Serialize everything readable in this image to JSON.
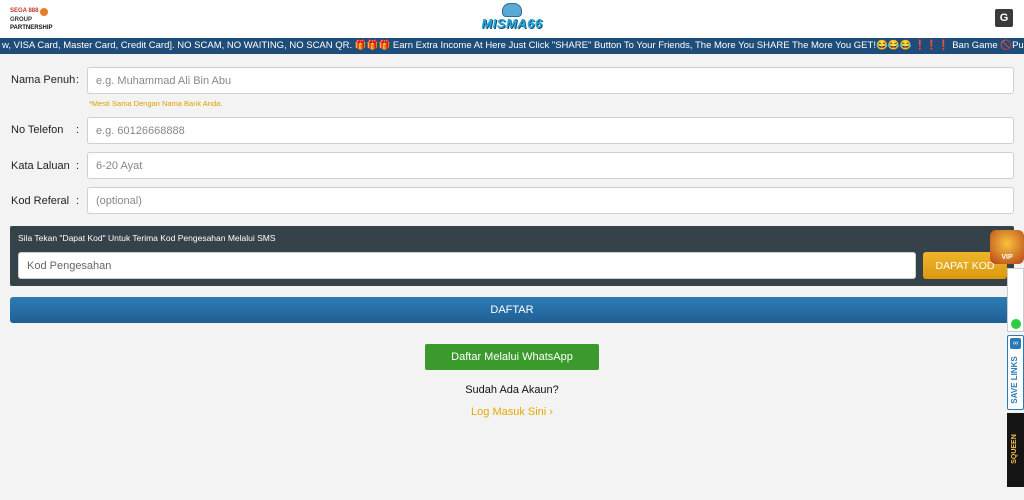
{
  "header": {
    "partner_logo": {
      "brand": "SEGA 888",
      "group": "GROUP",
      "caption": "PARTNERSHIP"
    },
    "main_logo": "MISMA66",
    "translate_icon": "translate-icon"
  },
  "marquee": {
    "text": "w, VISA Card, Master Card, Credit Card]. NO SCAM, NO WAITING, NO SCAN QR. 🎁🎁🎁 Earn Extra Income At Here Just Click \"SHARE\" Button To Your Friends, The More You SHARE The More You GET!😂😂😂 ❗❗❗ Ban Game 🚫Pussy All Fish Game!!!"
  },
  "form": {
    "full_name": {
      "label": "Nama Penuh",
      "colon": ":",
      "placeholder": "e.g. Muhammad Ali Bin Abu",
      "hint": "*Mesti Sama Dengan Nama Bank Anda."
    },
    "phone": {
      "label": "No Telefon",
      "colon": ":",
      "placeholder": "e.g. 60126668888"
    },
    "password": {
      "label": "Kata Laluan",
      "colon": ":",
      "placeholder": "6-20 Ayat"
    },
    "referral": {
      "label": "Kod Referal",
      "colon": ":",
      "placeholder": "(optional)"
    }
  },
  "sms": {
    "instruction": "Sila Tekan \"Dapat Kod\" Untuk Terima Kod Pengesahan Melalui SMS",
    "code_placeholder": "Kod Pengesahan",
    "get_code_label": "DAPAT KOD"
  },
  "actions": {
    "register_label": "DAFTAR",
    "whatsapp_label": "Daftar Melalui WhatsApp",
    "have_account": "Sudah Ada Akaun?",
    "login_link": "Log Masuk Sini ›"
  },
  "side_widgets": {
    "vip": "VIP",
    "save_links": "SAVE LINKS",
    "queen": "SQUEEN"
  },
  "colors": {
    "marquee_bg": "#1e4d7a",
    "panel_bg": "#36424a",
    "accent_gold": "#e6a800",
    "register_blue": "#2e7cb4",
    "whatsapp_green": "#3a9a2c"
  }
}
